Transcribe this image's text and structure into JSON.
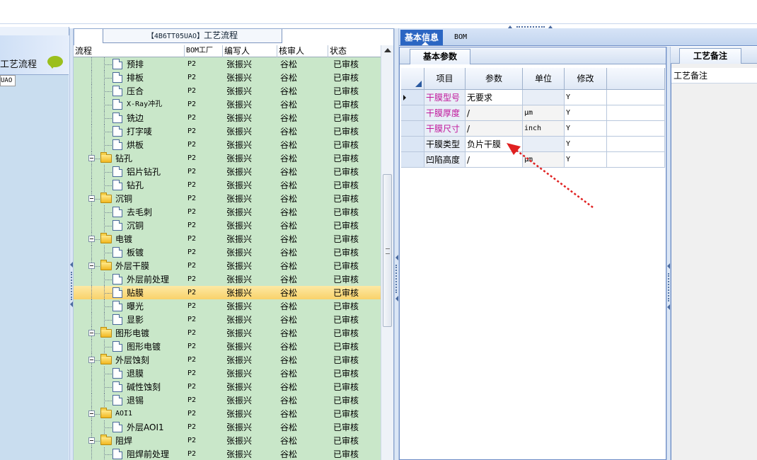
{
  "left_pane": {
    "title": "工艺流程",
    "tab_label": "UAO"
  },
  "tree_panel": {
    "title_code": "【4B6TT05UAO】",
    "title_text": "工艺流程"
  },
  "tree_columns": [
    "流程",
    "BOM工厂",
    "编写人",
    "核审人",
    "状态"
  ],
  "tree_rows": [
    {
      "name": "预排",
      "type": "doc",
      "level": 2,
      "factory": "P2",
      "author": "张振兴",
      "reviewer": "谷松",
      "status": "已审核"
    },
    {
      "name": "排板",
      "type": "doc",
      "level": 2,
      "factory": "P2",
      "author": "张振兴",
      "reviewer": "谷松",
      "status": "已审核"
    },
    {
      "name": "压合",
      "type": "doc",
      "level": 2,
      "factory": "P2",
      "author": "张振兴",
      "reviewer": "谷松",
      "status": "已审核"
    },
    {
      "name": "X-Ray冲孔",
      "type": "doc",
      "level": 2,
      "factory": "P2",
      "author": "张振兴",
      "reviewer": "谷松",
      "status": "已审核"
    },
    {
      "name": "铣边",
      "type": "doc",
      "level": 2,
      "factory": "P2",
      "author": "张振兴",
      "reviewer": "谷松",
      "status": "已审核"
    },
    {
      "name": "打字唛",
      "type": "doc",
      "level": 2,
      "factory": "P2",
      "author": "张振兴",
      "reviewer": "谷松",
      "status": "已审核"
    },
    {
      "name": "烘板",
      "type": "doc",
      "level": 2,
      "factory": "P2",
      "author": "张振兴",
      "reviewer": "谷松",
      "status": "已审核"
    },
    {
      "name": "钻孔",
      "type": "folder",
      "level": 1,
      "factory": "P2",
      "author": "张振兴",
      "reviewer": "谷松",
      "status": "已审核"
    },
    {
      "name": "铝片钻孔",
      "type": "doc",
      "level": 2,
      "factory": "P2",
      "author": "张振兴",
      "reviewer": "谷松",
      "status": "已审核"
    },
    {
      "name": "钻孔",
      "type": "doc",
      "level": 2,
      "factory": "P2",
      "author": "张振兴",
      "reviewer": "谷松",
      "status": "已审核"
    },
    {
      "name": "沉铜",
      "type": "folder",
      "level": 1,
      "factory": "P2",
      "author": "张振兴",
      "reviewer": "谷松",
      "status": "已审核"
    },
    {
      "name": "去毛刺",
      "type": "doc",
      "level": 2,
      "factory": "P2",
      "author": "张振兴",
      "reviewer": "谷松",
      "status": "已审核"
    },
    {
      "name": "沉铜",
      "type": "doc",
      "level": 2,
      "factory": "P2",
      "author": "张振兴",
      "reviewer": "谷松",
      "status": "已审核"
    },
    {
      "name": "电镀",
      "type": "folder",
      "level": 1,
      "factory": "P2",
      "author": "张振兴",
      "reviewer": "谷松",
      "status": "已审核"
    },
    {
      "name": "板镀",
      "type": "doc",
      "level": 2,
      "factory": "P2",
      "author": "张振兴",
      "reviewer": "谷松",
      "status": "已审核"
    },
    {
      "name": "外层干膜",
      "type": "folder",
      "level": 1,
      "factory": "P2",
      "author": "张振兴",
      "reviewer": "谷松",
      "status": "已审核"
    },
    {
      "name": "外层前处理",
      "type": "doc",
      "level": 2,
      "factory": "P2",
      "author": "张振兴",
      "reviewer": "谷松",
      "status": "已审核"
    },
    {
      "name": "贴膜",
      "type": "doc",
      "level": 2,
      "factory": "P2",
      "author": "张振兴",
      "reviewer": "谷松",
      "status": "已审核",
      "selected": true
    },
    {
      "name": "曝光",
      "type": "doc",
      "level": 2,
      "factory": "P2",
      "author": "张振兴",
      "reviewer": "谷松",
      "status": "已审核"
    },
    {
      "name": "显影",
      "type": "doc",
      "level": 2,
      "factory": "P2",
      "author": "张振兴",
      "reviewer": "谷松",
      "status": "已审核"
    },
    {
      "name": "图形电镀",
      "type": "folder",
      "level": 1,
      "factory": "P2",
      "author": "张振兴",
      "reviewer": "谷松",
      "status": "已审核"
    },
    {
      "name": "图形电镀",
      "type": "doc",
      "level": 2,
      "factory": "P2",
      "author": "张振兴",
      "reviewer": "谷松",
      "status": "已审核"
    },
    {
      "name": "外层蚀刻",
      "type": "folder",
      "level": 1,
      "factory": "P2",
      "author": "张振兴",
      "reviewer": "谷松",
      "status": "已审核"
    },
    {
      "name": "退膜",
      "type": "doc",
      "level": 2,
      "factory": "P2",
      "author": "张振兴",
      "reviewer": "谷松",
      "status": "已审核"
    },
    {
      "name": "碱性蚀刻",
      "type": "doc",
      "level": 2,
      "factory": "P2",
      "author": "张振兴",
      "reviewer": "谷松",
      "status": "已审核"
    },
    {
      "name": "退锡",
      "type": "doc",
      "level": 2,
      "factory": "P2",
      "author": "张振兴",
      "reviewer": "谷松",
      "status": "已审核"
    },
    {
      "name": "AOI1",
      "type": "folder",
      "level": 1,
      "factory": "P2",
      "author": "张振兴",
      "reviewer": "谷松",
      "status": "已审核"
    },
    {
      "name": "外层AOI1",
      "type": "doc",
      "level": 2,
      "factory": "P2",
      "author": "张振兴",
      "reviewer": "谷松",
      "status": "已审核"
    },
    {
      "name": "阻焊",
      "type": "folder",
      "level": 1,
      "factory": "P2",
      "author": "张振兴",
      "reviewer": "谷松",
      "status": "已审核"
    },
    {
      "name": "阻焊前处理",
      "type": "doc",
      "level": 2,
      "factory": "P2",
      "author": "张振兴",
      "reviewer": "谷松",
      "status": "已审核"
    }
  ],
  "top_tabs": [
    "基本信息",
    "BOM"
  ],
  "sub_tab": "基本参数",
  "param_columns": [
    "项目",
    "参数",
    "单位",
    "修改"
  ],
  "param_rows": [
    {
      "item": "干膜型号",
      "param": "无要求",
      "unit": "",
      "modify": "Y",
      "highlight": true,
      "current": true
    },
    {
      "item": "干膜厚度",
      "param": "/",
      "unit": "μm",
      "modify": "Y",
      "highlight": true
    },
    {
      "item": "干膜尺寸",
      "param": "/",
      "unit": "inch",
      "modify": "Y",
      "highlight": true
    },
    {
      "item": "干膜类型",
      "param": "负片干膜",
      "unit": "",
      "modify": "Y",
      "highlight": false
    },
    {
      "item": "凹陷高度",
      "param": "/",
      "unit": "μm",
      "modify": "Y",
      "highlight": false
    }
  ],
  "notes_tab": "工艺备注",
  "notes_header": "工艺备注",
  "colors": {
    "tree_bg": "#c9e7c9",
    "selected": "#f9d26a",
    "accent": "#2b66c3",
    "highlight_text": "#c0169b",
    "arrow": "#e02020"
  }
}
